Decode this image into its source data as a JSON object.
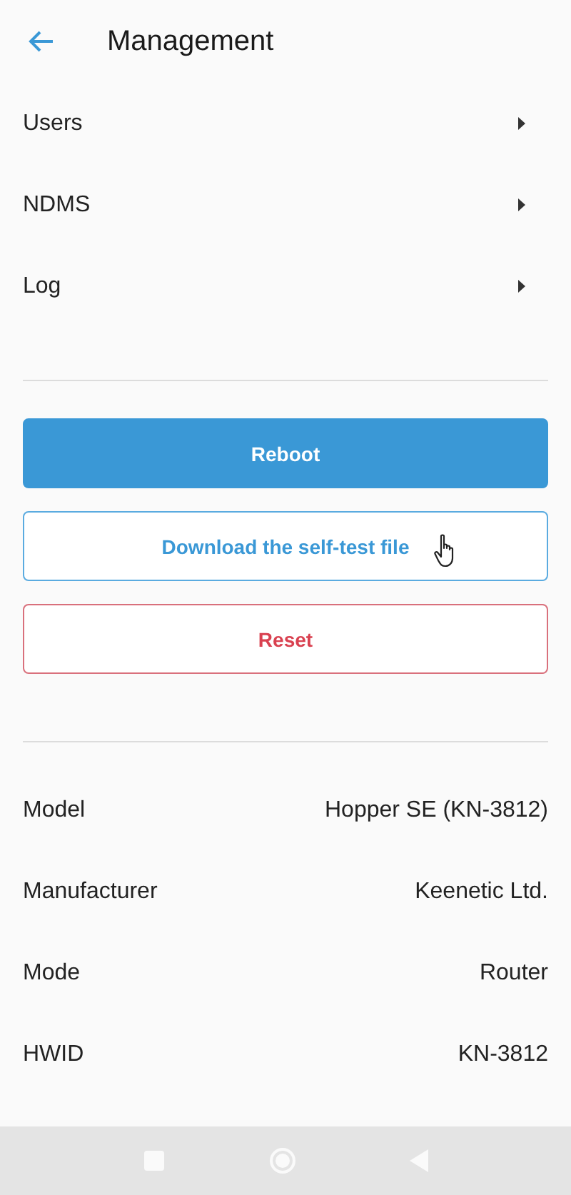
{
  "header": {
    "title": "Management"
  },
  "menu": [
    {
      "label": "Users"
    },
    {
      "label": "NDMS"
    },
    {
      "label": "Log"
    }
  ],
  "buttons": [
    {
      "label": "Reboot",
      "kind": "primary",
      "hovered": false
    },
    {
      "label": "Download the self-test file",
      "kind": "outline",
      "hovered": true
    },
    {
      "label": "Reset",
      "kind": "danger",
      "hovered": false
    }
  ],
  "info": [
    {
      "label": "Model",
      "value": "Hopper SE (KN-3812)"
    },
    {
      "label": "Manufacturer",
      "value": "Keenetic Ltd."
    },
    {
      "label": "Mode",
      "value": "Router"
    },
    {
      "label": "HWID",
      "value": "KN-3812"
    }
  ]
}
